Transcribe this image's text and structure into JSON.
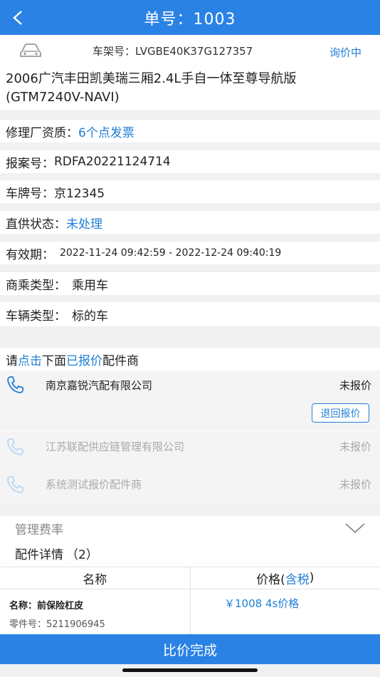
{
  "header": {
    "title": "单号：1003"
  },
  "vehicle": {
    "vin_label": "车架号：",
    "vin": "LVGBE40K37G127357",
    "status": "询价中",
    "model_line1": "2006广汽丰田凯美瑞三厢2.4L手自一体至尊导航版",
    "model_line2": "(GTM7240V-NAVI)"
  },
  "info": {
    "garage_label": "修理厂资质：",
    "garage_value": "6个点发票",
    "case_label": "报案号：",
    "case_value": "RDFA20221124714",
    "plate_label": "车牌号：",
    "plate_value": "京12345",
    "direct_label": "直供状态：",
    "direct_value": "未处理",
    "valid_label": "有效期：",
    "valid_value": "2022-11-24 09:42:59 - 2022-12-24 09:40:19",
    "biz_label": "商乘类型：",
    "biz_value": "乘用车",
    "vtype_label": "车辆类型：",
    "vtype_value": "标的车"
  },
  "hint": {
    "p1": "请",
    "p2": "点击",
    "p3": "下面",
    "p4": "已报价",
    "p5": "配件商"
  },
  "suppliers": [
    {
      "name": "南京嘉锐汽配有限公司",
      "state": "未报价",
      "action": "退回报价"
    },
    {
      "name": "江苏联配供应链管理有限公司",
      "state": "未报价"
    },
    {
      "name": "系统测试报价配件商",
      "state": "未报价"
    }
  ],
  "fee": {
    "label": "管理费率"
  },
  "parts": {
    "label": "配件详情",
    "count": "（2）",
    "col_name": "名称",
    "col_price_a": "价格(",
    "col_price_b": "含税",
    "col_price_c": ")",
    "rows": [
      {
        "name_label": "名称：",
        "name": "前保险杠皮",
        "part_label": "零件号：",
        "part_no": "5211906945",
        "price": "￥1008 4s价格"
      }
    ]
  },
  "actions": {
    "finish": "比价完成"
  },
  "colors": {
    "primary": "#2b82e5",
    "link": "#1f7fd6"
  }
}
